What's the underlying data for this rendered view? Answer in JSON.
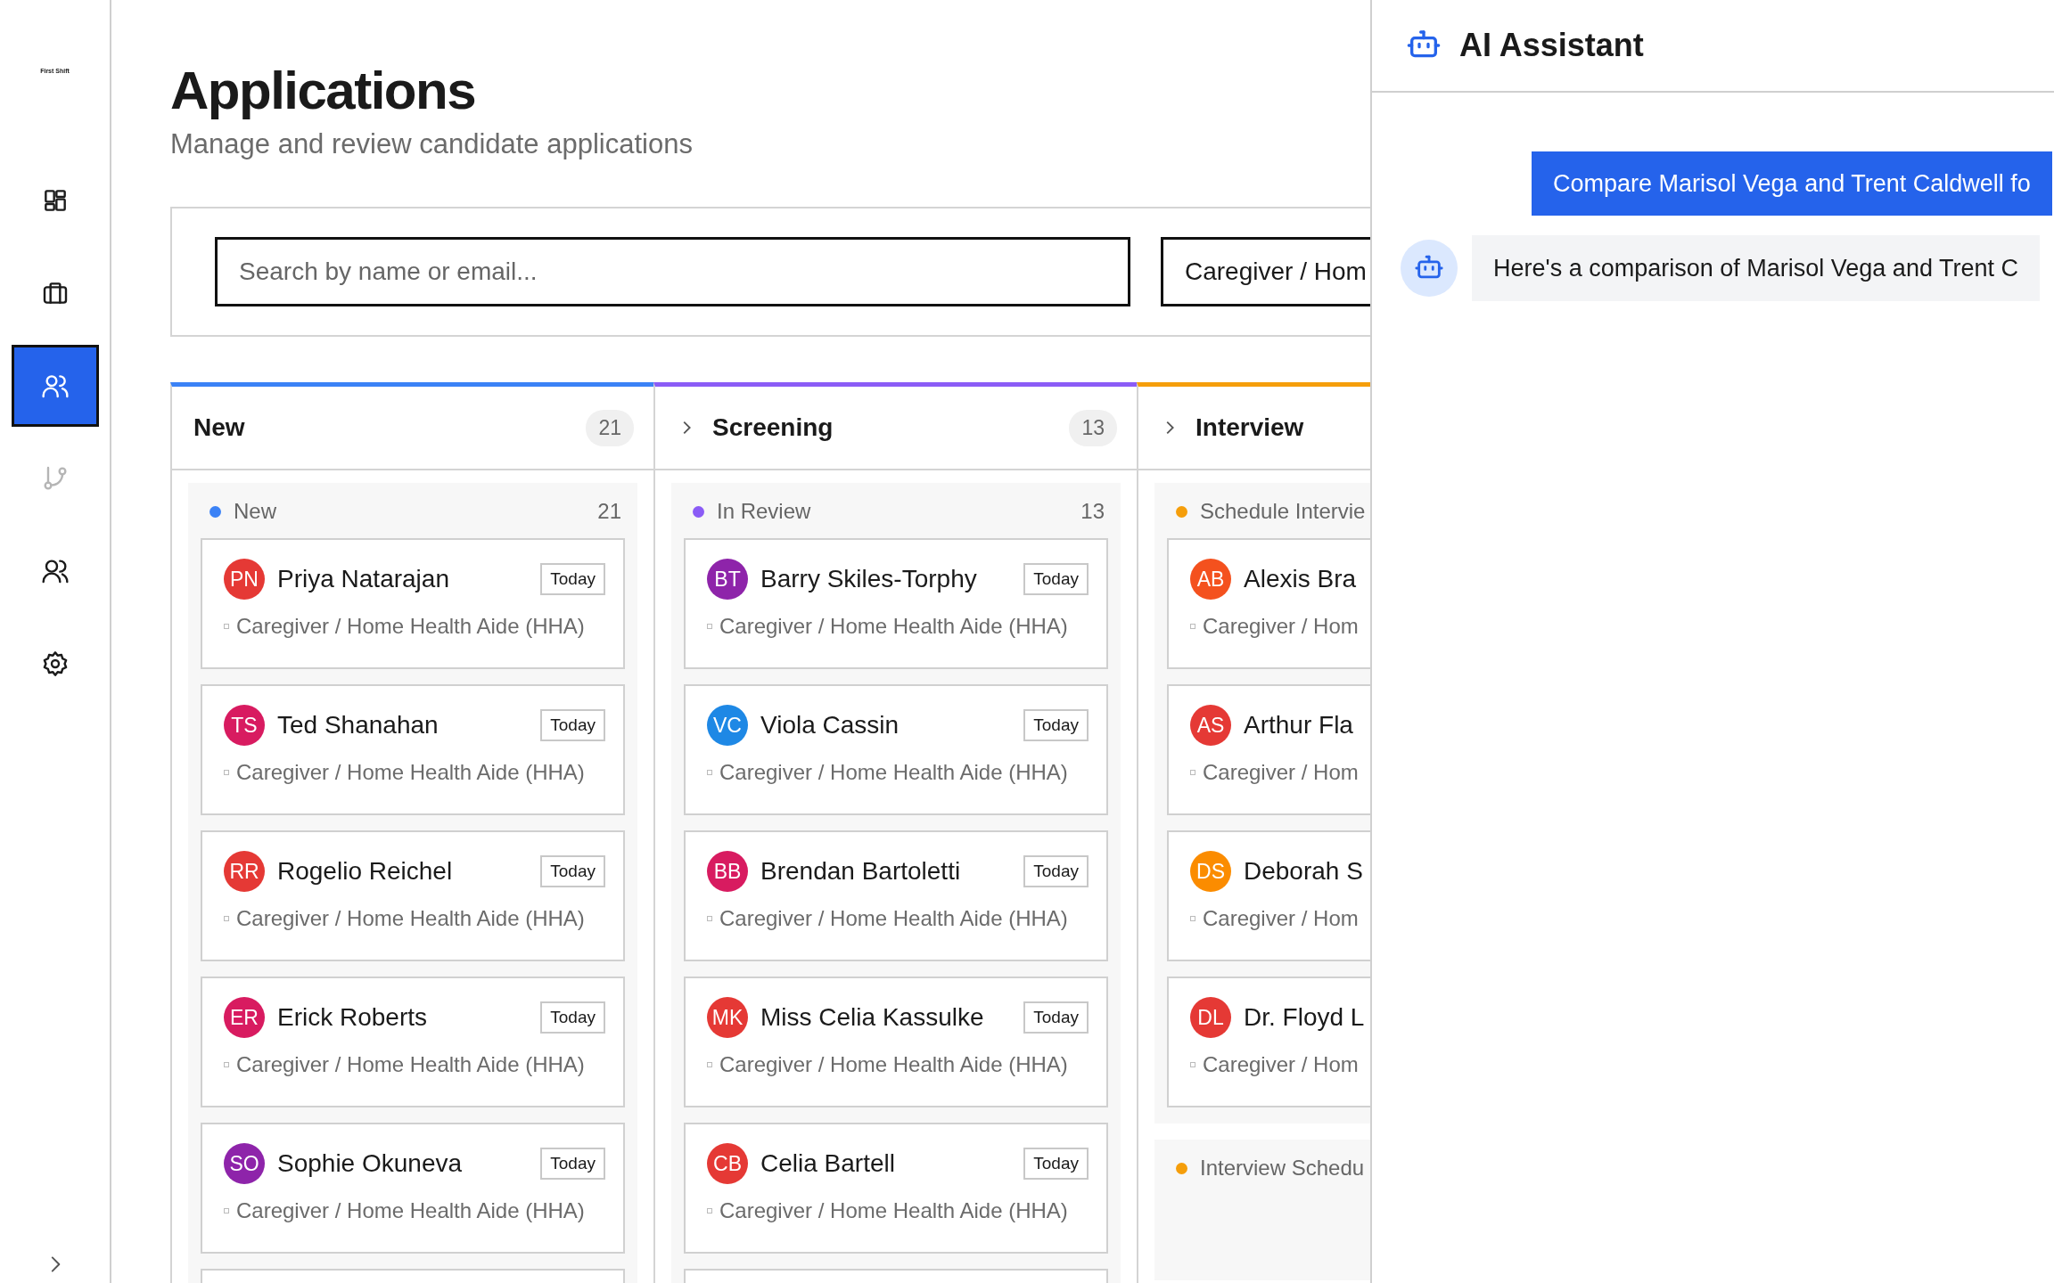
{
  "sidebar": {
    "logo": "First Shift",
    "nav": [
      {
        "kind": "dashboard",
        "selected": false,
        "disabled": false
      },
      {
        "kind": "briefcase",
        "selected": false,
        "disabled": false
      },
      {
        "kind": "users",
        "selected": true,
        "disabled": false
      },
      {
        "kind": "branch",
        "selected": false,
        "disabled": true
      },
      {
        "kind": "people",
        "selected": false,
        "disabled": false
      },
      {
        "kind": "settings",
        "selected": false,
        "disabled": false
      }
    ]
  },
  "header": {
    "title": "Applications",
    "subtitle": "Manage and review candidate applications"
  },
  "filters": {
    "search": {
      "placeholder": "Search by name or email..."
    },
    "role_select": {
      "value": "Caregiver / Hom"
    }
  },
  "columns": [
    {
      "title": "New",
      "count": "21",
      "color": "#3b82f6",
      "toggle": false,
      "groups": [
        {
          "label": "New",
          "count": "21",
          "color": "#3b82f6",
          "cards": [
            {
              "initials": "PN",
              "name": "Priya Natarajan",
              "color": "#e53935",
              "badge": "Today",
              "role": "Caregiver / Home Health Aide (HHA)"
            },
            {
              "initials": "TS",
              "name": "Ted Shanahan",
              "color": "#d81b60",
              "badge": "Today",
              "role": "Caregiver / Home Health Aide (HHA)"
            },
            {
              "initials": "RR",
              "name": "Rogelio Reichel",
              "color": "#e53935",
              "badge": "Today",
              "role": "Caregiver / Home Health Aide (HHA)"
            },
            {
              "initials": "ER",
              "name": "Erick Roberts",
              "color": "#d81b60",
              "badge": "Today",
              "role": "Caregiver / Home Health Aide (HHA)"
            },
            {
              "initials": "SO",
              "name": "Sophie Okuneva",
              "color": "#8e24aa",
              "badge": "Today",
              "role": "Caregiver / Home Health Aide (HHA)"
            }
          ]
        }
      ]
    },
    {
      "title": "Screening",
      "count": "13",
      "color": "#8b5cf6",
      "toggle": true,
      "groups": [
        {
          "label": "In Review",
          "count": "13",
          "color": "#8b5cf6",
          "cards": [
            {
              "initials": "BT",
              "name": "Barry Skiles-Torphy",
              "color": "#8e24aa",
              "badge": "Today",
              "role": "Caregiver / Home Health Aide (HHA)"
            },
            {
              "initials": "VC",
              "name": "Viola Cassin",
              "color": "#1e88e5",
              "badge": "Today",
              "role": "Caregiver / Home Health Aide (HHA)"
            },
            {
              "initials": "BB",
              "name": "Brendan Bartoletti",
              "color": "#d81b60",
              "badge": "Today",
              "role": "Caregiver / Home Health Aide (HHA)"
            },
            {
              "initials": "MK",
              "name": "Miss Celia Kassulke",
              "color": "#e53935",
              "badge": "Today",
              "role": "Caregiver / Home Health Aide (HHA)"
            },
            {
              "initials": "CB",
              "name": "Celia Bartell",
              "color": "#e53935",
              "badge": "Today",
              "role": "Caregiver / Home Health Aide (HHA)"
            }
          ]
        }
      ]
    },
    {
      "title": "Interview",
      "color": "#f59e0b",
      "toggle": true,
      "groups": [
        {
          "label": "Schedule Intervie",
          "color": "#f59e0b",
          "cards": [
            {
              "initials": "AB",
              "name": "Alexis Bra",
              "color": "#f4511e",
              "role": "Caregiver / Hom"
            },
            {
              "initials": "AS",
              "name": "Arthur Fla",
              "color": "#e53935",
              "role": "Caregiver / Hom"
            },
            {
              "initials": "DS",
              "name": "Deborah S",
              "color": "#fb8c00",
              "role": "Caregiver / Hom"
            },
            {
              "initials": "DL",
              "name": "Dr. Floyd L",
              "color": "#e53935",
              "role": "Caregiver / Hom"
            }
          ]
        },
        {
          "label": "Interview Schedu",
          "color": "#f59e0b"
        }
      ]
    }
  ],
  "assistant": {
    "title": "AI Assistant",
    "messages": [
      {
        "kind": "user",
        "text": "Compare Marisol Vega and Trent Caldwell fo"
      },
      {
        "kind": "bot",
        "text": "Here's a comparison of Marisol Vega and Trent C"
      }
    ]
  }
}
